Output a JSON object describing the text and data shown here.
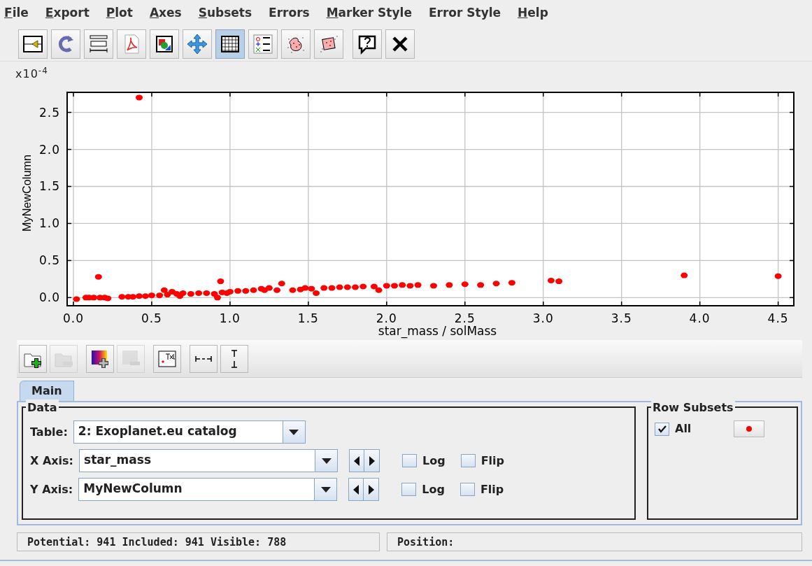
{
  "menu": [
    {
      "label": "File",
      "underline_first": true
    },
    {
      "label": "Export",
      "underline_first": true
    },
    {
      "label": "Plot",
      "underline_first": true
    },
    {
      "label": "Axes",
      "underline_first": true
    },
    {
      "label": "Subsets",
      "underline_first": true
    },
    {
      "label": "Errors",
      "underline_first": false
    },
    {
      "label": "Marker Style",
      "underline_first": true
    },
    {
      "label": "Error Style",
      "underline_first": false
    },
    {
      "label": "Help",
      "underline_first": true
    }
  ],
  "toolbar": [
    {
      "selected": false
    },
    {
      "selected": false
    },
    {
      "selected": false
    },
    {
      "selected": false
    },
    {
      "selected": false
    },
    {
      "selected": false
    },
    {
      "selected": true
    },
    {
      "selected": false
    },
    {
      "selected": false
    },
    {
      "selected": false
    },
    {
      "selected": false
    },
    {
      "selected": false
    }
  ],
  "plot": {
    "exponent_label": "x10$^{-4}$",
    "chart_data": {
      "type": "scatter",
      "grid": true,
      "xlabel": "star_mass / solMass",
      "ylabel": "MyNewColumn",
      "xlim": [
        -0.04,
        4.6
      ],
      "ylim": [
        -0.11,
        2.77
      ],
      "xticks": [
        {
          "value": 0,
          "label": "0.0"
        },
        {
          "value": 0.5,
          "label": "0.5"
        },
        {
          "value": 1,
          "label": "1.0"
        },
        {
          "value": 1.5,
          "label": "1.5"
        },
        {
          "value": 2,
          "label": "2.0"
        },
        {
          "value": 2.5,
          "label": "2.5"
        },
        {
          "value": 3,
          "label": "3.0"
        },
        {
          "value": 3.5,
          "label": "3.5"
        },
        {
          "value": 4,
          "label": "4.0"
        },
        {
          "value": 4.5,
          "label": "4.5"
        }
      ],
      "yticks": [
        {
          "value": 0,
          "label": "0.0"
        },
        {
          "value": 0.5,
          "label": "0.5"
        },
        {
          "value": 1,
          "label": "1.0"
        },
        {
          "value": 1.5,
          "label": "1.5"
        },
        {
          "value": 2,
          "label": "2.0"
        },
        {
          "value": 2.5,
          "label": "2.5"
        }
      ],
      "x": [
        0.02,
        0.08,
        0.1,
        0.13,
        0.16,
        0.17,
        0.2,
        0.22,
        0.31,
        0.35,
        0.38,
        0.42,
        0.42,
        0.46,
        0.5,
        0.55,
        0.58,
        0.6,
        0.63,
        0.66,
        0.68,
        0.7,
        0.75,
        0.8,
        0.85,
        0.9,
        0.92,
        0.94,
        0.95,
        0.98,
        1.0,
        1.05,
        1.1,
        1.15,
        1.2,
        1.22,
        1.25,
        1.3,
        1.33,
        1.4,
        1.45,
        1.48,
        1.52,
        1.55,
        1.6,
        1.65,
        1.7,
        1.75,
        1.8,
        1.85,
        1.92,
        1.95,
        2.0,
        2.05,
        2.1,
        2.15,
        2.2,
        2.3,
        2.4,
        2.5,
        2.6,
        2.7,
        2.8,
        3.05,
        3.1,
        3.9,
        4.5
      ],
      "series": [
        {
          "color": "#ff0000",
          "values": [
            -0.02,
            0.0,
            0.0,
            0.0,
            0.28,
            0.0,
            0.0,
            -0.01,
            0.01,
            0.01,
            0.01,
            2.7,
            0.02,
            0.02,
            0.03,
            0.03,
            0.1,
            0.04,
            0.08,
            0.05,
            0.02,
            0.06,
            0.05,
            0.06,
            0.06,
            0.05,
            0.0,
            0.22,
            0.07,
            0.06,
            0.08,
            0.09,
            0.09,
            0.1,
            0.12,
            0.1,
            0.13,
            0.1,
            0.19,
            0.1,
            0.11,
            0.13,
            0.12,
            0.06,
            0.13,
            0.13,
            0.14,
            0.14,
            0.14,
            0.15,
            0.15,
            0.1,
            0.16,
            0.16,
            0.17,
            0.16,
            0.17,
            0.16,
            0.17,
            0.18,
            0.17,
            0.19,
            0.2,
            0.23,
            0.22,
            0.3,
            0.29
          ]
        }
      ]
    }
  },
  "layer_toolbar": [
    {
      "disabled": false
    },
    {
      "disabled": true
    },
    {
      "disabled": false
    },
    {
      "disabled": true
    },
    {
      "disabled": false
    },
    {
      "disabled": false
    },
    {
      "disabled": false
    }
  ],
  "tabs": [
    {
      "label": "Main",
      "selected": true
    }
  ],
  "data_panel": {
    "title": "Data",
    "table_label": "Table:",
    "table_value": "2: Exoplanet.eu catalog",
    "axes": [
      {
        "label": "X Axis:",
        "value": "star_mass",
        "log": {
          "label": "Log",
          "checked": false
        },
        "flip": {
          "label": "Flip",
          "checked": false
        }
      },
      {
        "label": "Y Axis:",
        "value": "MyNewColumn",
        "log": {
          "label": "Log",
          "checked": false
        },
        "flip": {
          "label": "Flip",
          "checked": false
        }
      }
    ]
  },
  "row_subsets": {
    "title": "Row Subsets",
    "items": [
      {
        "label": "All",
        "checked": true,
        "color": "#ff0000"
      }
    ]
  },
  "status_bar": {
    "counts": "Potential: 941 Included: 941 Visible: 788",
    "position": "Position:"
  }
}
